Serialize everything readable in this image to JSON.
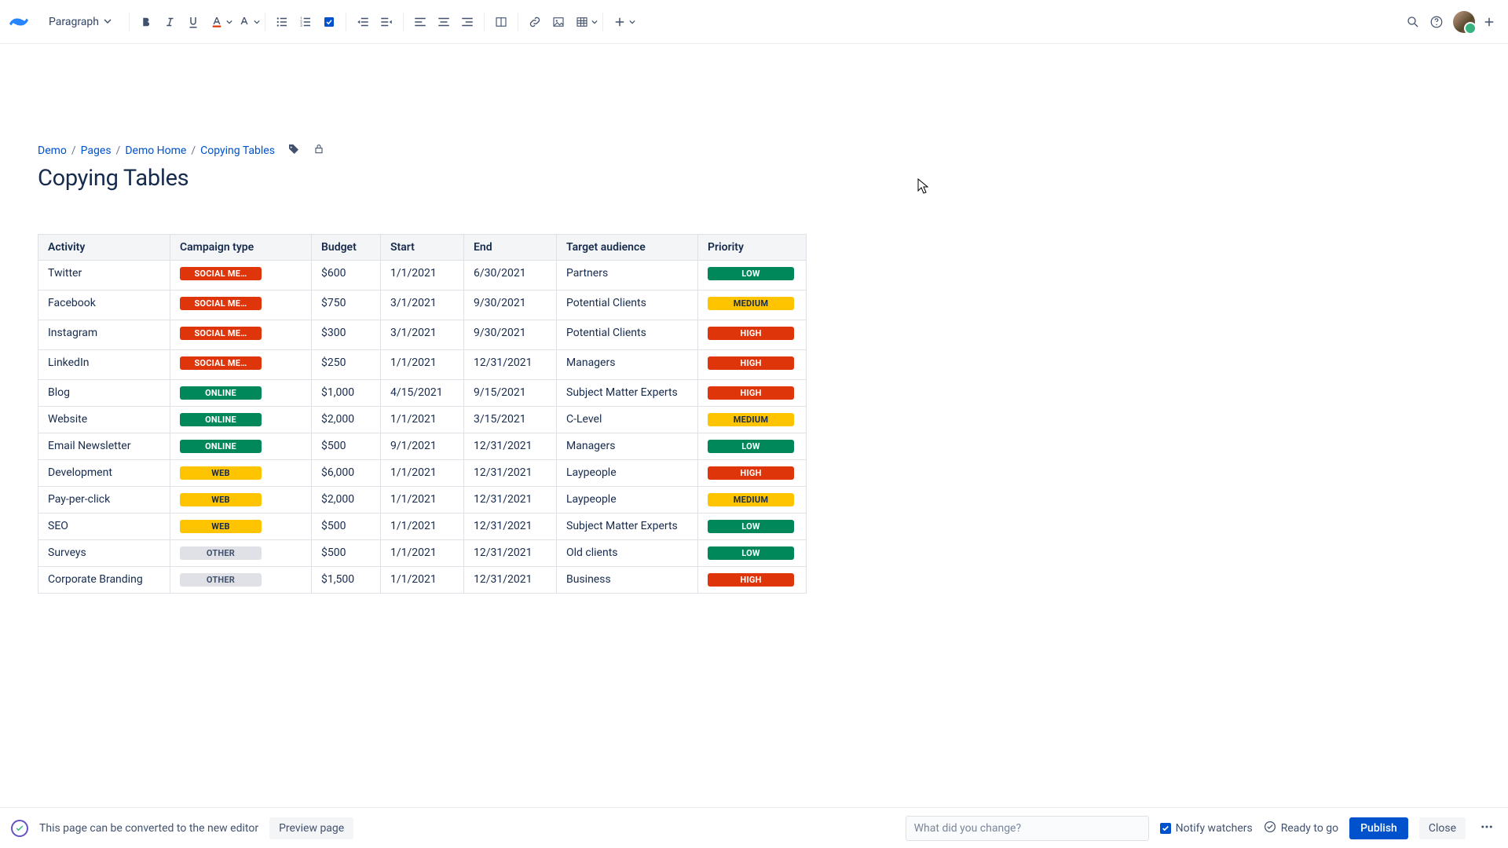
{
  "toolbar": {
    "paragraph_label": "Paragraph"
  },
  "breadcrumb": {
    "items": [
      "Demo",
      "Pages",
      "Demo Home",
      "Copying Tables"
    ]
  },
  "page": {
    "title": "Copying Tables"
  },
  "table": {
    "headers": {
      "activity": "Activity",
      "campaign_type": "Campaign type",
      "budget": "Budget",
      "start": "Start",
      "end": "End",
      "target_audience": "Target audience",
      "priority": "Priority"
    },
    "rows": [
      {
        "activity": "Twitter",
        "type_label": "SOCIAL ME…",
        "type_class": "lz-social",
        "budget": "$600",
        "start": "1/1/2021",
        "end": "6/30/2021",
        "audience": "Partners",
        "priority_label": "LOW",
        "priority_class": "lz-low"
      },
      {
        "activity": "Facebook",
        "type_label": "SOCIAL ME…",
        "type_class": "lz-social",
        "budget": "$750",
        "start": "3/1/2021",
        "end": "9/30/2021",
        "audience": "Potential Clients",
        "priority_label": "MEDIUM",
        "priority_class": "lz-med"
      },
      {
        "activity": "Instagram",
        "type_label": "SOCIAL ME…",
        "type_class": "lz-social",
        "budget": "$300",
        "start": "3/1/2021",
        "end": "9/30/2021",
        "audience": "Potential Clients",
        "priority_label": "HIGH",
        "priority_class": "lz-high"
      },
      {
        "activity": "LinkedIn",
        "type_label": "SOCIAL ME…",
        "type_class": "lz-social",
        "budget": "$250",
        "start": "1/1/2021",
        "end": "12/31/2021",
        "audience": "Managers",
        "priority_label": "HIGH",
        "priority_class": "lz-high"
      },
      {
        "activity": "Blog",
        "type_label": "ONLINE",
        "type_class": "lz-online",
        "budget": "$1,000",
        "start": "4/15/2021",
        "end": "9/15/2021",
        "audience": "Subject Matter Experts",
        "priority_label": "HIGH",
        "priority_class": "lz-high"
      },
      {
        "activity": "Website",
        "type_label": "ONLINE",
        "type_class": "lz-online",
        "budget": "$2,000",
        "start": "1/1/2021",
        "end": "3/15/2021",
        "audience": "C-Level",
        "priority_label": "MEDIUM",
        "priority_class": "lz-med"
      },
      {
        "activity": "Email Newsletter",
        "type_label": "ONLINE",
        "type_class": "lz-online",
        "budget": "$500",
        "start": "9/1/2021",
        "end": "12/31/2021",
        "audience": "Managers",
        "priority_label": "LOW",
        "priority_class": "lz-low"
      },
      {
        "activity": "Development",
        "type_label": "WEB",
        "type_class": "lz-web",
        "budget": "$6,000",
        "start": "1/1/2021",
        "end": "12/31/2021",
        "audience": "Laypeople",
        "priority_label": "HIGH",
        "priority_class": "lz-high"
      },
      {
        "activity": "Pay-per-click",
        "type_label": "WEB",
        "type_class": "lz-web",
        "budget": "$2,000",
        "start": "1/1/2021",
        "end": "12/31/2021",
        "audience": "Laypeople",
        "priority_label": "MEDIUM",
        "priority_class": "lz-med"
      },
      {
        "activity": "SEO",
        "type_label": "WEB",
        "type_class": "lz-web",
        "budget": "$500",
        "start": "1/1/2021",
        "end": "12/31/2021",
        "audience": "Subject Matter Experts",
        "priority_label": "LOW",
        "priority_class": "lz-low"
      },
      {
        "activity": "Surveys",
        "type_label": "OTHER",
        "type_class": "lz-other",
        "budget": "$500",
        "start": "1/1/2021",
        "end": "12/31/2021",
        "audience": "Old clients",
        "priority_label": "LOW",
        "priority_class": "lz-low"
      },
      {
        "activity": "Corporate Branding",
        "type_label": "OTHER",
        "type_class": "lz-other",
        "budget": "$1,500",
        "start": "1/1/2021",
        "end": "12/31/2021",
        "audience": "Business",
        "priority_label": "HIGH",
        "priority_class": "lz-high"
      }
    ]
  },
  "footer": {
    "convert_text": "This page can be converted to the new editor",
    "preview_label": "Preview page",
    "comment_placeholder": "What did you change?",
    "notify_label": "Notify watchers",
    "ready_label": "Ready to go",
    "publish_label": "Publish",
    "close_label": "Close"
  }
}
